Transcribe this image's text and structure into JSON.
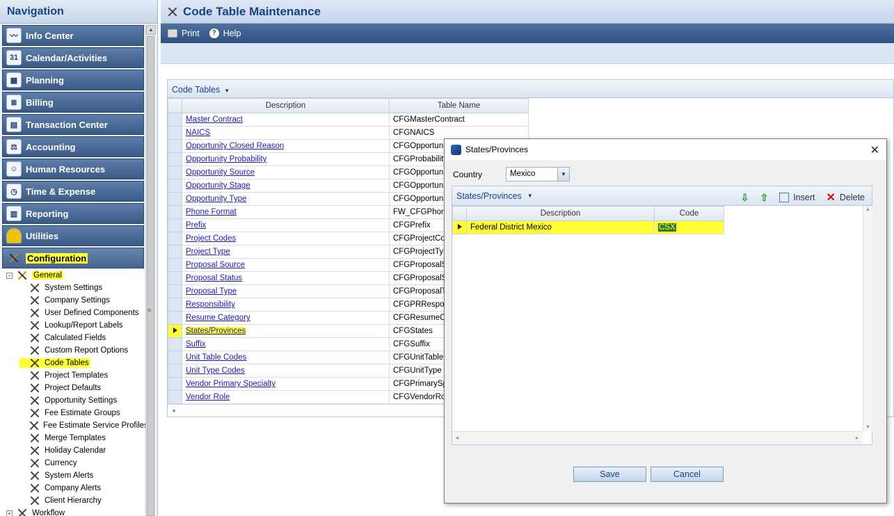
{
  "nav": {
    "title": "Navigation",
    "items": [
      {
        "label": "Info Center",
        "icon": "info-center-icon"
      },
      {
        "label": "Calendar/Activities",
        "icon": "calendar-icon"
      },
      {
        "label": "Planning",
        "icon": "planning-icon"
      },
      {
        "label": "Billing",
        "icon": "billing-icon"
      },
      {
        "label": "Transaction Center",
        "icon": "transaction-icon"
      },
      {
        "label": "Accounting",
        "icon": "scales-icon"
      },
      {
        "label": "Human Resources",
        "icon": "people-icon"
      },
      {
        "label": "Time & Expense",
        "icon": "clock-icon"
      },
      {
        "label": "Reporting",
        "icon": "report-icon"
      },
      {
        "label": "Utilities",
        "icon": "hardhat-icon"
      },
      {
        "label": "Configuration",
        "icon": "tools-icon"
      }
    ],
    "calendar_day": "31",
    "tree": {
      "general": "General",
      "children": [
        "System Settings",
        "Company Settings",
        "User Defined Components",
        "Lookup/Report Labels",
        "Calculated Fields",
        "Custom Report Options",
        "Code Tables",
        "Project Templates",
        "Project Defaults",
        "Opportunity Settings",
        "Fee Estimate Groups",
        "Fee Estimate Service Profiles",
        "Merge Templates",
        "Holiday Calendar",
        "Currency",
        "System Alerts",
        "Company Alerts",
        "Client Hierarchy"
      ],
      "workflow": "Workflow"
    }
  },
  "main": {
    "title": "Code Table Maintenance",
    "toolbar": {
      "print": "Print",
      "help": "Help"
    },
    "code_tables": {
      "header": "Code Tables",
      "columns": [
        "Description",
        "Table Name"
      ],
      "rows": [
        {
          "description": "Master Contract",
          "table": "CFGMasterContract"
        },
        {
          "description": "NAICS",
          "table": "CFGNAICS"
        },
        {
          "description": "Opportunity Closed Reason",
          "table": "CFGOpportuni"
        },
        {
          "description": "Opportunity Probability",
          "table": "CFGProbability"
        },
        {
          "description": "Opportunity Source",
          "table": "CFGOpportuni"
        },
        {
          "description": "Opportunity Stage",
          "table": "CFGOpportuni"
        },
        {
          "description": "Opportunity Type",
          "table": "CFGOpportuni"
        },
        {
          "description": "Phone Format",
          "table": "FW_CFGPhone"
        },
        {
          "description": "Prefix",
          "table": "CFGPrefix"
        },
        {
          "description": "Project Codes",
          "table": "CFGProjectCod"
        },
        {
          "description": "Project Type",
          "table": "CFGProjectTyp"
        },
        {
          "description": "Proposal Source",
          "table": "CFGProposalS"
        },
        {
          "description": "Proposal Status",
          "table": "CFGProposalS"
        },
        {
          "description": "Proposal Type",
          "table": "CFGProposalTy"
        },
        {
          "description": "Responsibility",
          "table": "CFGPRRespon"
        },
        {
          "description": "Resume Category",
          "table": "CFGResumeCa"
        },
        {
          "description": "States/Provinces",
          "table": "CFGStates"
        },
        {
          "description": "Suffix",
          "table": "CFGSuffix"
        },
        {
          "description": "Unit Table Codes",
          "table": "CFGUnitTableC"
        },
        {
          "description": "Unit Type Codes",
          "table": "CFGUnitType"
        },
        {
          "description": "Vendor Primary Specialty",
          "table": "CFGPrimarySp"
        },
        {
          "description": "Vendor Role",
          "table": "CFGVendorRol"
        }
      ]
    }
  },
  "dialog": {
    "title": "States/Provinces",
    "country_label": "Country",
    "country_value": "Mexico",
    "panel_header": "States/Provinces",
    "insert": "Insert",
    "delete": "Delete",
    "columns": [
      "Description",
      "Code"
    ],
    "rows": [
      {
        "description": "Federal District Mexico",
        "code": "CSX"
      }
    ],
    "save": "Save",
    "cancel": "Cancel"
  },
  "colors": {
    "highlight": "#ffff33",
    "nav_blue": "#3a5b86",
    "link": "#1a1ab8"
  }
}
